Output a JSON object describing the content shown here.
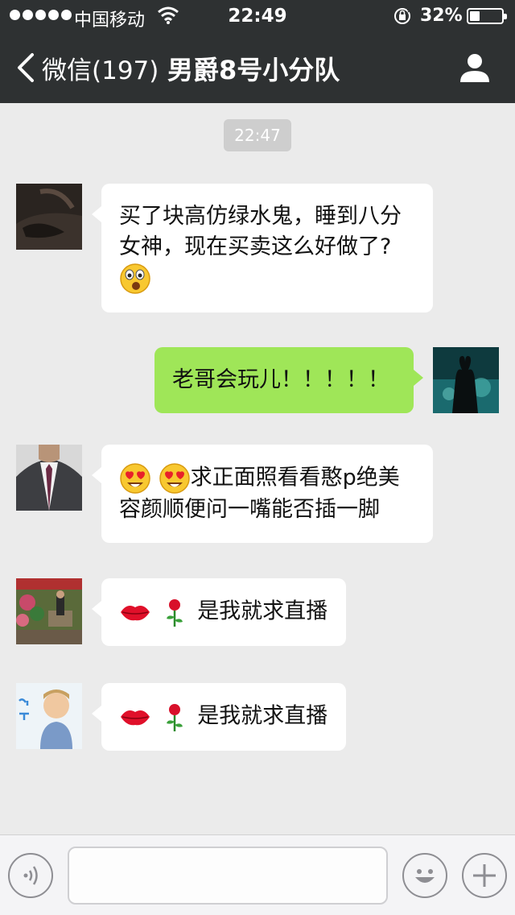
{
  "status_bar": {
    "carrier": "中国移动",
    "time": "22:49",
    "battery_percent": "32%",
    "battery_level": 0.32
  },
  "nav": {
    "back_label": "微信(197)",
    "title": "男爵8号小分队"
  },
  "chat": {
    "timestamp": "22:47",
    "messages": [
      {
        "side": "left",
        "text": "买了块高仿绿水鬼，睡到八分女神，现在买卖这么好做了?",
        "emoji_after": [
          "astonished-face-icon"
        ]
      },
      {
        "side": "right",
        "text": "老哥会玩儿！！！！！"
      },
      {
        "side": "left",
        "emoji_before": [
          "heart-eyes-face-icon",
          "heart-eyes-face-icon"
        ],
        "text": "求正面照看看憨p绝美容颜顺便问一嘴能否插一脚"
      },
      {
        "side": "left",
        "emoji_before": [
          "lips-icon",
          "rose-icon"
        ],
        "text": "是我就求直播"
      },
      {
        "side": "left",
        "emoji_before": [
          "lips-icon",
          "rose-icon"
        ],
        "text": "是我就求直播"
      }
    ]
  },
  "input": {
    "placeholder": ""
  },
  "colors": {
    "header_bg": "#2e3132",
    "chat_bg": "#ebebeb",
    "own_bubble": "#9fe658",
    "other_bubble": "#ffffff"
  }
}
